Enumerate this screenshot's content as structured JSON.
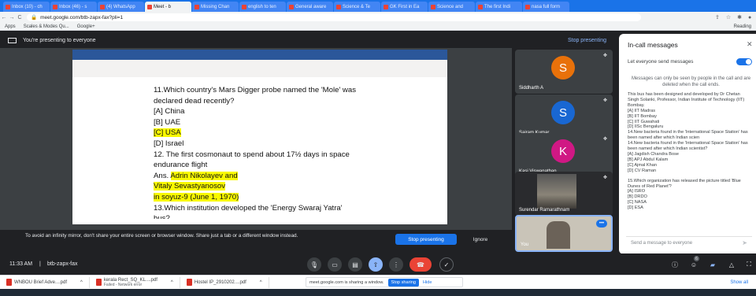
{
  "browser": {
    "tabs": [
      {
        "label": "Inbox (10) - ch",
        "active": false
      },
      {
        "label": "Inbox (46) - s",
        "active": false
      },
      {
        "label": "(4) WhatsApp",
        "active": false
      },
      {
        "label": "Meet - b",
        "active": true
      },
      {
        "label": "Missing Chan",
        "active": false
      },
      {
        "label": "english to ten",
        "active": false
      },
      {
        "label": "General aware",
        "active": false
      },
      {
        "label": "Science & Te",
        "active": false
      },
      {
        "label": "GK First in Ea",
        "active": false
      },
      {
        "label": "Science and",
        "active": false
      },
      {
        "label": "The first Indi",
        "active": false
      },
      {
        "label": "nasa full form",
        "active": false
      }
    ],
    "url": "meet.google.com/btb-zapx-fax?pli=1",
    "bookmarks": [
      "Apps",
      "Scales & Modes Qu...",
      "Google+"
    ],
    "reading_list": "Reading"
  },
  "presenting": {
    "banner": "You're presenting to everyone",
    "stop_link": "Stop presenting"
  },
  "doc": {
    "lines": [
      {
        "text": "11.Which country's Mars Digger probe named the 'Mole' was",
        "highlight": false
      },
      {
        "text": "declared dead recently?",
        "highlight": false
      },
      {
        "text": "[A] China",
        "highlight": false
      },
      {
        "text": "[B] UAE",
        "highlight": false
      },
      {
        "text": "[C] USA",
        "highlight": true
      },
      {
        "text": "[D] Israel",
        "highlight": false
      },
      {
        "text": "12. The first cosmonaut to spend about 17½ days in space",
        "highlight": false
      },
      {
        "text": "endurance flight",
        "highlight": false
      },
      {
        "text": "Ans. Adrin Nikolayev and",
        "highlight": "partial"
      },
      {
        "text": "Vitaly Sevastyanosov",
        "highlight": true
      },
      {
        "text": "in soyuz-9 (June 1, 1970)",
        "highlight": true
      },
      {
        "text": "13.Which institution developed the 'Energy Swaraj Yatra'",
        "highlight": false
      },
      {
        "text": "bus?",
        "highlight": false
      }
    ],
    "footer": "This bus has been designed and developed by Dr Chetan Singh Solanki, Professor, Indian Institute of Technology (IIT) B"
  },
  "notice": {
    "text": "To avoid an infinity mirror, don't share your entire screen or browser window. Share just a tab or a different window instead.",
    "stop_btn": "Stop presenting",
    "ignore_btn": "Ignore"
  },
  "participants": [
    {
      "name": "Siddharth A",
      "initial": "S",
      "color": "#e8710a"
    },
    {
      "name": "Sairam Kumar",
      "initial": "S",
      "color": "#1967d2"
    },
    {
      "name": "Kasi Viswanathan",
      "initial": "K",
      "color": "#d01884"
    },
    {
      "name": "Surendar Ramarathnam",
      "initial": ""
    },
    {
      "name": "You",
      "initial": ""
    }
  ],
  "panel": {
    "title": "In-call messages",
    "toggle_label": "Let everyone send messages",
    "note": "Messages can only be seen by people in the call and are deleted when the call ends.",
    "messages": [
      "This bus has been designed and developed by Dr Chetan Singh Solanki, Professor, Indian Institute of Technology (IIT) Bombay.",
      "[A] IIT Madras",
      "[B] IIT Bombay",
      "[C] IIT Guwahati",
      "[D] IISc Bengaluru",
      "14.New bacteria found in the 'International Space Station' has been named after which Indian scien",
      "14.New bacteria found in the 'International Space Station' has been named after which Indian scientist?",
      "[A] Jagdish Chandra Bose",
      "[B] APJ Abdul Kalam",
      "[C] Ajmal Khan",
      "[D] CV Raman",
      "",
      "15.Which organization has released the picture titled 'Blue Dunes of Red Planet'?",
      "[A] ISRO",
      "[B] DRDO",
      "[C] NASA",
      "[D] ESA"
    ],
    "input_placeholder": "Send a message to everyone"
  },
  "controls": {
    "time": "11:33 AM",
    "meeting_code": "btb-zapx-fax",
    "people_count": "6"
  },
  "downloads": [
    {
      "name": "WNBOU Brief Adve....pdf",
      "status": ""
    },
    {
      "name": "kerala Rect_SQ_KL....pdf",
      "status": "Failed - Network error"
    },
    {
      "name": "Hostel IP_2910202....pdf",
      "status": ""
    }
  ],
  "sharing_bar": {
    "text": "meet.google.com is sharing a window.",
    "stop": "Stop sharing",
    "hide": "Hide"
  },
  "show_all": "Show all"
}
